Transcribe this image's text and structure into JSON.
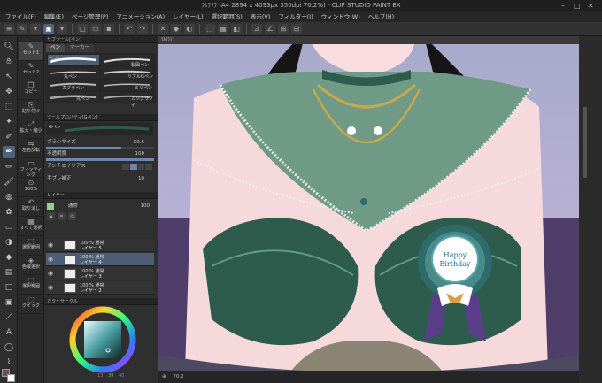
{
  "window": {
    "title": "ﾗﾙﾌﾗﾌ (A4 2894 x 4093px 350dpi 70.2%) - CLIP STUDIO PAINT EX"
  },
  "menu": [
    "ファイル(F)",
    "編集(E)",
    "ページ管理(P)",
    "アニメーション(A)",
    "レイヤー(L)",
    "選択範囲(S)",
    "表示(V)",
    "フィルター(I)",
    "ウィンドウ(W)",
    "ヘルプ(H)"
  ],
  "subtools": [
    {
      "label": "セット1",
      "icon": "✎"
    },
    {
      "label": "セット2",
      "icon": "✎"
    },
    {
      "label": "コピー",
      "icon": "❐"
    },
    {
      "label": "貼り付け",
      "icon": "⎘"
    },
    {
      "label": "拡大・縮小",
      "icon": "⤢"
    },
    {
      "label": "左右反転",
      "icon": "⇋"
    },
    {
      "label": "フィッティング",
      "icon": "▭"
    },
    {
      "label": "100%",
      "icon": "⊙"
    },
    {
      "label": "取り消し",
      "icon": "↶"
    },
    {
      "label": "すべて選択",
      "icon": "▦"
    },
    {
      "label": "選択範囲",
      "icon": "⬚"
    },
    {
      "label": "色域選択",
      "icon": "◈"
    },
    {
      "label": "選択範囲",
      "icon": "⬚"
    },
    {
      "label": "クイック",
      "icon": "⬚"
    }
  ],
  "brushPanel": {
    "header": "サブツール[ペン]",
    "tabs": [
      "ペン",
      "マーカー"
    ],
    "brushes": [
      {
        "name": "Gペン",
        "selected": true
      },
      {
        "name": "丸ペン"
      },
      {
        "name": "カブラペン"
      },
      {
        "name": "リアルGペン"
      },
      {
        "name": "丸ペン"
      },
      {
        "name": "ミリペン"
      },
      {
        "name": "カリグラフィ"
      },
      {
        "name": "製図ペン"
      }
    ]
  },
  "toolProperty": {
    "header": "ツールプロパティ[Gペン]",
    "name": "Gペン",
    "rows": [
      {
        "label": "ブラシサイズ",
        "value": "60.5"
      },
      {
        "label": "不透明度",
        "value": "100"
      },
      {
        "label": "アンチエイリアス",
        "value": ""
      },
      {
        "label": "手ブレ補正",
        "value": "10"
      }
    ]
  },
  "layerPanel": {
    "header": "レイヤー",
    "blend": "通常",
    "opacity": "100",
    "layers": [
      {
        "mode": "100 % 通常",
        "name": "レイヤー 5",
        "selected": false
      },
      {
        "mode": "100 % 通常",
        "name": "レイヤー 4",
        "selected": true
      },
      {
        "mode": "100 % 通常",
        "name": "レイヤー 3",
        "selected": false
      },
      {
        "mode": "100 % 通常",
        "name": "レイヤー 2",
        "selected": false
      }
    ]
  },
  "colorPanel": {
    "header": "カラーサークル",
    "r": "13",
    "g": "39",
    "b": "40"
  },
  "canvas": {
    "tabLabel": "ﾗﾙﾌﾗﾌ",
    "badgeText": [
      "Happy",
      "Birthday"
    ]
  },
  "status": {
    "zoom": "70.2"
  },
  "colors": {
    "accent": "#51627b",
    "bodice": "#2e5c4c",
    "shawl": "#6f9a86",
    "gold": "#c9a84a",
    "skin": "#f6d9db"
  }
}
